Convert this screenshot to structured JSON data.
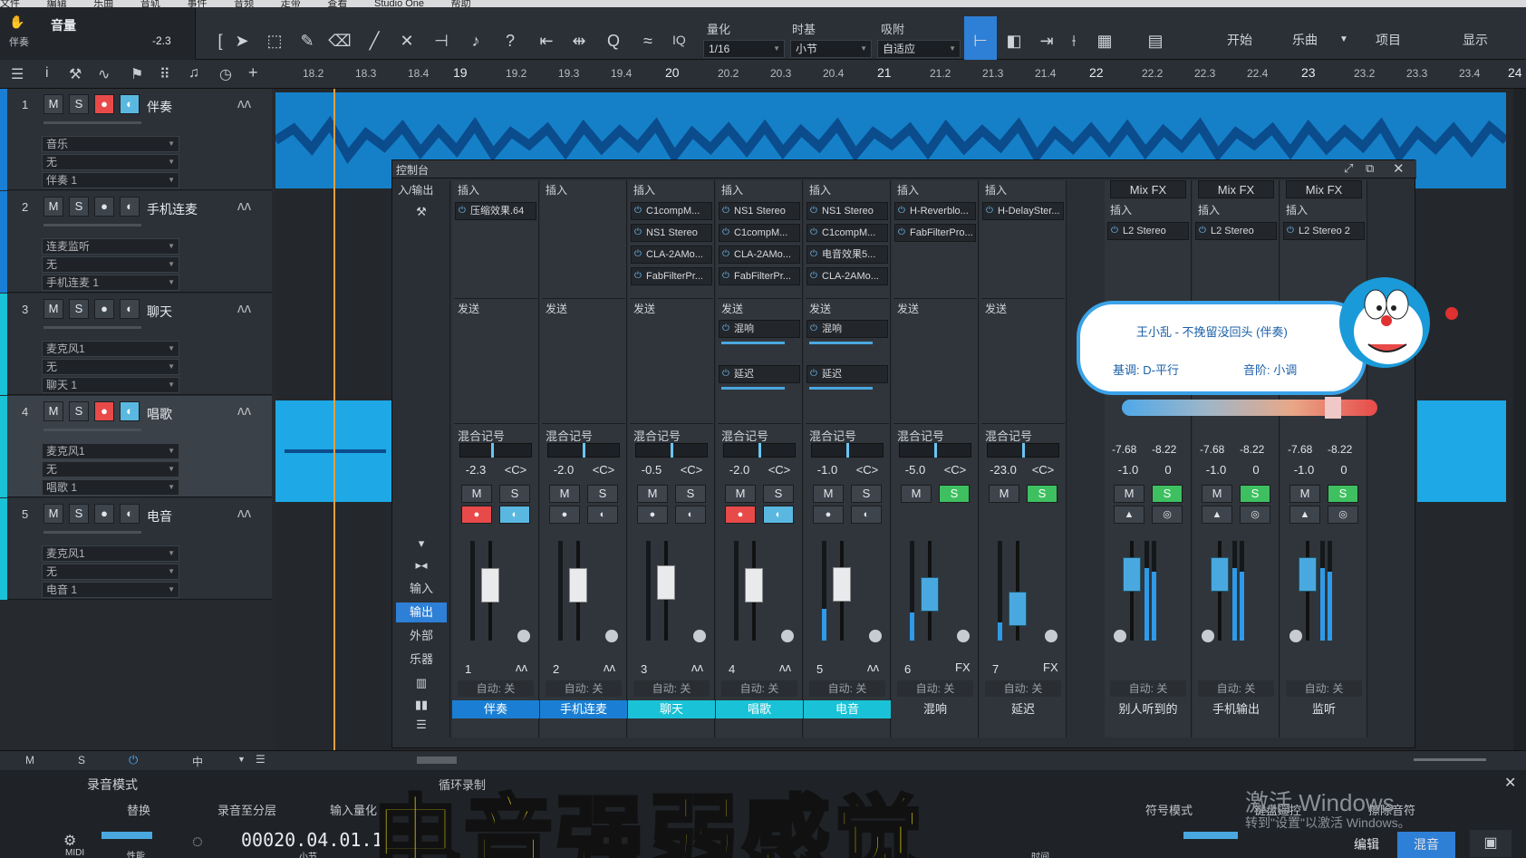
{
  "menu": [
    "文件",
    "编辑",
    "乐曲",
    "音轨",
    "事件",
    "音频",
    "走带",
    "查看",
    "Studio One",
    "帮助"
  ],
  "track_info": {
    "label": "音量",
    "track": "伴奏",
    "value": "-2.3"
  },
  "toolbar": {
    "quantize_label": "量化",
    "quantize_value": "1/16",
    "timebase_label": "时基",
    "timebase_value": "小节",
    "snap_label": "吸附",
    "snap_value": "自适应",
    "iq": "IQ",
    "start": "开始",
    "song": "乐曲",
    "project": "项目",
    "display": "显示"
  },
  "ruler": [
    "18.2",
    "18.3",
    "18.4",
    "19",
    "19.2",
    "19.3",
    "19.4",
    "20",
    "20.2",
    "20.3",
    "20.4",
    "21",
    "21.2",
    "21.3",
    "21.4",
    "22",
    "22.2",
    "22.3",
    "22.4",
    "23",
    "23.2",
    "23.3",
    "23.4",
    "24"
  ],
  "tracks": [
    {
      "num": "1",
      "name": "伴奏",
      "input": "音乐",
      "sub": "无",
      "out": "伴奏 1",
      "color": "#1a7fd4",
      "rec": true,
      "mon": true
    },
    {
      "num": "2",
      "name": "手机连麦",
      "input": "连麦监听",
      "sub": "无",
      "out": "手机连麦 1",
      "color": "#1a7fd4",
      "rec": false,
      "mon": false
    },
    {
      "num": "3",
      "name": "聊天",
      "input": "麦克风1",
      "sub": "无",
      "out": "聊天 1",
      "color": "#19c2d6",
      "rec": false,
      "mon": false
    },
    {
      "num": "4",
      "name": "唱歌",
      "input": "麦克风1",
      "sub": "无",
      "out": "唱歌 1",
      "color": "#19c2d6",
      "rec": true,
      "mon": true
    },
    {
      "num": "5",
      "name": "电音",
      "input": "麦克风1",
      "sub": "无",
      "out": "电音 1",
      "color": "#19c2d6",
      "rec": false,
      "mon": false
    }
  ],
  "console": {
    "title": "控制台",
    "io_label": "入/输出",
    "insert": "插入",
    "send": "发送",
    "mixlabel": "混合记号",
    "auto": "自动: 关",
    "side": [
      "输入",
      "输出",
      "外部",
      "乐器"
    ],
    "channels": [
      {
        "num": "1",
        "name": "伴奏",
        "vol": "-2.3",
        "pan": "<C>",
        "plugins": [
          "压缩效果.64"
        ],
        "sends": [],
        "namecolor": "#1a7fd4",
        "rec": true,
        "mon": true,
        "panpos": 0.45,
        "fader": 0.62,
        "mstate": "",
        "meter": 0.0
      },
      {
        "num": "2",
        "name": "手机连麦",
        "vol": "-2.0",
        "pan": "<C>",
        "plugins": [],
        "sends": [],
        "namecolor": "#1a7fd4",
        "rec": false,
        "mon": false,
        "panpos": 0.5,
        "fader": 0.63,
        "mstate": "",
        "meter": 0.0
      },
      {
        "num": "3",
        "name": "聊天",
        "vol": "-0.5",
        "pan": "<C>",
        "plugins": [
          "C1compM...",
          "NS1 Stereo",
          "CLA-2AMo...",
          "FabFilterPr..."
        ],
        "sends": [],
        "namecolor": "#19c2d6",
        "rec": false,
        "mon": false,
        "panpos": 0.5,
        "fader": 0.66,
        "mstate": "",
        "meter": 0.0
      },
      {
        "num": "4",
        "name": "唱歌",
        "vol": "-2.0",
        "pan": "<C>",
        "plugins": [
          "NS1 Stereo",
          "C1compM...",
          "CLA-2AMo...",
          "FabFilterPr..."
        ],
        "sends": [
          "混响",
          "延迟"
        ],
        "namecolor": "#19c2d6",
        "rec": true,
        "mon": true,
        "panpos": 0.5,
        "fader": 0.63,
        "mstate": "",
        "meter": 0.0
      },
      {
        "num": "5",
        "name": "电音",
        "vol": "-1.0",
        "pan": "<C>",
        "plugins": [
          "NS1 Stereo",
          "C1compM...",
          "电音效果5...",
          "CLA-2AMo..."
        ],
        "sends": [
          "混响",
          "延迟"
        ],
        "namecolor": "#19c2d6",
        "rec": false,
        "mon": false,
        "panpos": 0.5,
        "fader": 0.64,
        "mstate": "",
        "meter": 0.32
      },
      {
        "num": "6",
        "name": "混响",
        "vol": "-5.0",
        "pan": "<C>",
        "plugins": [
          "H-Reverblo...",
          "FabFilterPro..."
        ],
        "sends": [],
        "namecolor": "",
        "rec": false,
        "mon": false,
        "panpos": 0.5,
        "fader": 0.5,
        "mstate": "S",
        "meter": 0.28,
        "fx": true
      },
      {
        "num": "7",
        "name": "延迟",
        "vol": "-23.0",
        "pan": "<C>",
        "plugins": [
          "H-DelaySter..."
        ],
        "sends": [],
        "namecolor": "",
        "rec": false,
        "mon": false,
        "panpos": 0.5,
        "fader": 0.3,
        "mstate": "S",
        "meter": 0.18,
        "fx": true
      }
    ],
    "busses": [
      {
        "name": "别人听到的",
        "fx": "Mix FX",
        "plugin": "L2 Stereo",
        "lvl1": "-7.68",
        "lvl2": "-8.22",
        "vol": "-1.0",
        "pan": "0"
      },
      {
        "name": "手机输出",
        "fx": "Mix FX",
        "plugin": "L2 Stereo",
        "lvl1": "-7.68",
        "lvl2": "-8.22",
        "vol": "-1.0",
        "pan": "0"
      },
      {
        "name": "监听",
        "fx": "Mix FX",
        "plugin": "L2 Stereo 2",
        "lvl1": "-7.68",
        "lvl2": "-8.22",
        "vol": "-1.0",
        "pan": "0"
      }
    ]
  },
  "popup": {
    "title": "王小乱 - 不挽留没回头 (伴奏)",
    "key": "基调: D-平行",
    "scale": "音阶: 小调"
  },
  "status": {
    "m": "M",
    "s": "S",
    "mid": "中"
  },
  "record": {
    "title": "录音模式",
    "options": [
      "替换",
      "录音至分层",
      "输入量化",
      "循环录制",
      "符号模式",
      "键盘遥控",
      "擦除音符"
    ],
    "timecode": "00020.04.01.1",
    "midi": "MIDI",
    "perf": "性能",
    "bar": "小节",
    "time": "时间"
  },
  "caption": "电音强弱感觉",
  "watermark": {
    "line1": "激活 Windows",
    "line2": "转到\"设置\"以激活 Windows。"
  },
  "bottom_tabs": [
    "编辑",
    "混音"
  ]
}
